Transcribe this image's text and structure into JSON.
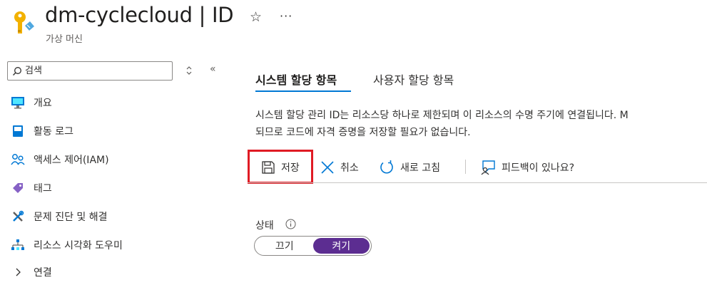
{
  "header": {
    "title": "dm-cyclecloud | ID",
    "subtitle": "가상 머신",
    "icon": "key-icon",
    "favorite_icon": "star-icon",
    "more_label": "···"
  },
  "sidebar": {
    "search_placeholder": "검색",
    "collapse_label": "«",
    "items": [
      {
        "label": "개요",
        "icon": "monitor-icon"
      },
      {
        "label": "활동 로그",
        "icon": "activity-log-icon"
      },
      {
        "label": "액세스 제어(IAM)",
        "icon": "people-icon"
      },
      {
        "label": "태그",
        "icon": "tag-icon"
      },
      {
        "label": "문제 진단 및 해결",
        "icon": "wrench-icon"
      },
      {
        "label": "리소스 시각화 도우미",
        "icon": "hierarchy-icon"
      },
      {
        "label": "연결",
        "icon": "chevron-right-icon"
      }
    ]
  },
  "main": {
    "tabs": [
      {
        "label": "시스템 할당 항목",
        "active": true
      },
      {
        "label": "사용자 할당 항목",
        "active": false
      }
    ],
    "description_line1": "시스템 할당 관리 ID는 리소스당 하나로 제한되며 이 리소스의 수명 주기에 연결됩니다. M",
    "description_line2": "되므로 코드에 자격 증명을 저장할 필요가 없습니다.",
    "toolbar": {
      "save_label": "저장",
      "cancel_label": "취소",
      "refresh_label": "새로 고침",
      "feedback_label": "피드백이 있나요?"
    },
    "status": {
      "label": "상태",
      "off_label": "끄기",
      "on_label": "켜기",
      "value": "켜기"
    }
  },
  "colors": {
    "accent": "#0078d4",
    "toggle_on": "#5c2d91",
    "highlight": "#e01b24"
  }
}
